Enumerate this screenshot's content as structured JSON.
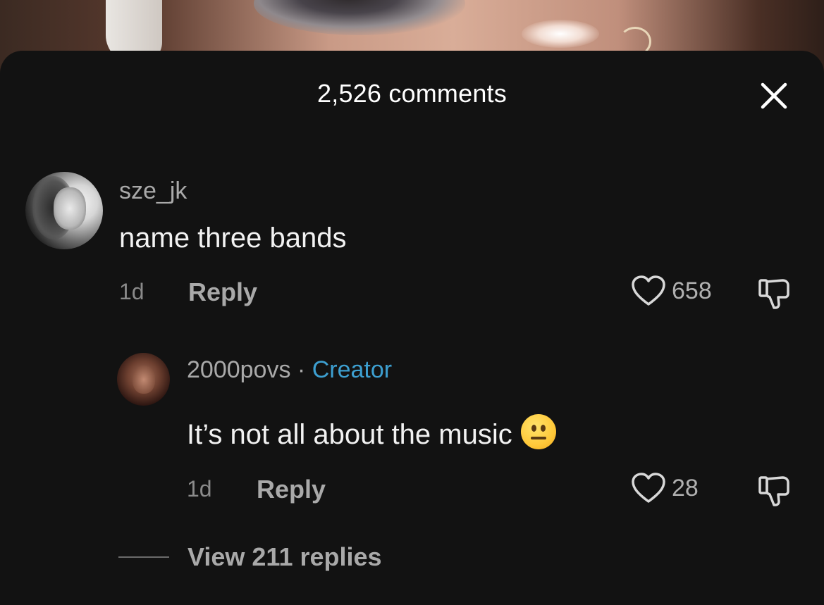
{
  "header": {
    "title": "2,526 comments",
    "close_icon": "close-icon"
  },
  "comments": [
    {
      "username": "sze_jk",
      "text": "name three bands",
      "time": "1d",
      "reply_label": "Reply",
      "likes": "658"
    }
  ],
  "reply": {
    "username": "2000povs",
    "separator": "·",
    "badge": "Creator",
    "text": "It’s not all about the music",
    "emoji": "neutral-face",
    "time": "1d",
    "reply_label": "Reply",
    "likes": "28"
  },
  "view_replies": {
    "label": "View 211 replies"
  },
  "colors": {
    "sheet_bg": "#121212",
    "creator_badge": "#3d9fd0"
  }
}
